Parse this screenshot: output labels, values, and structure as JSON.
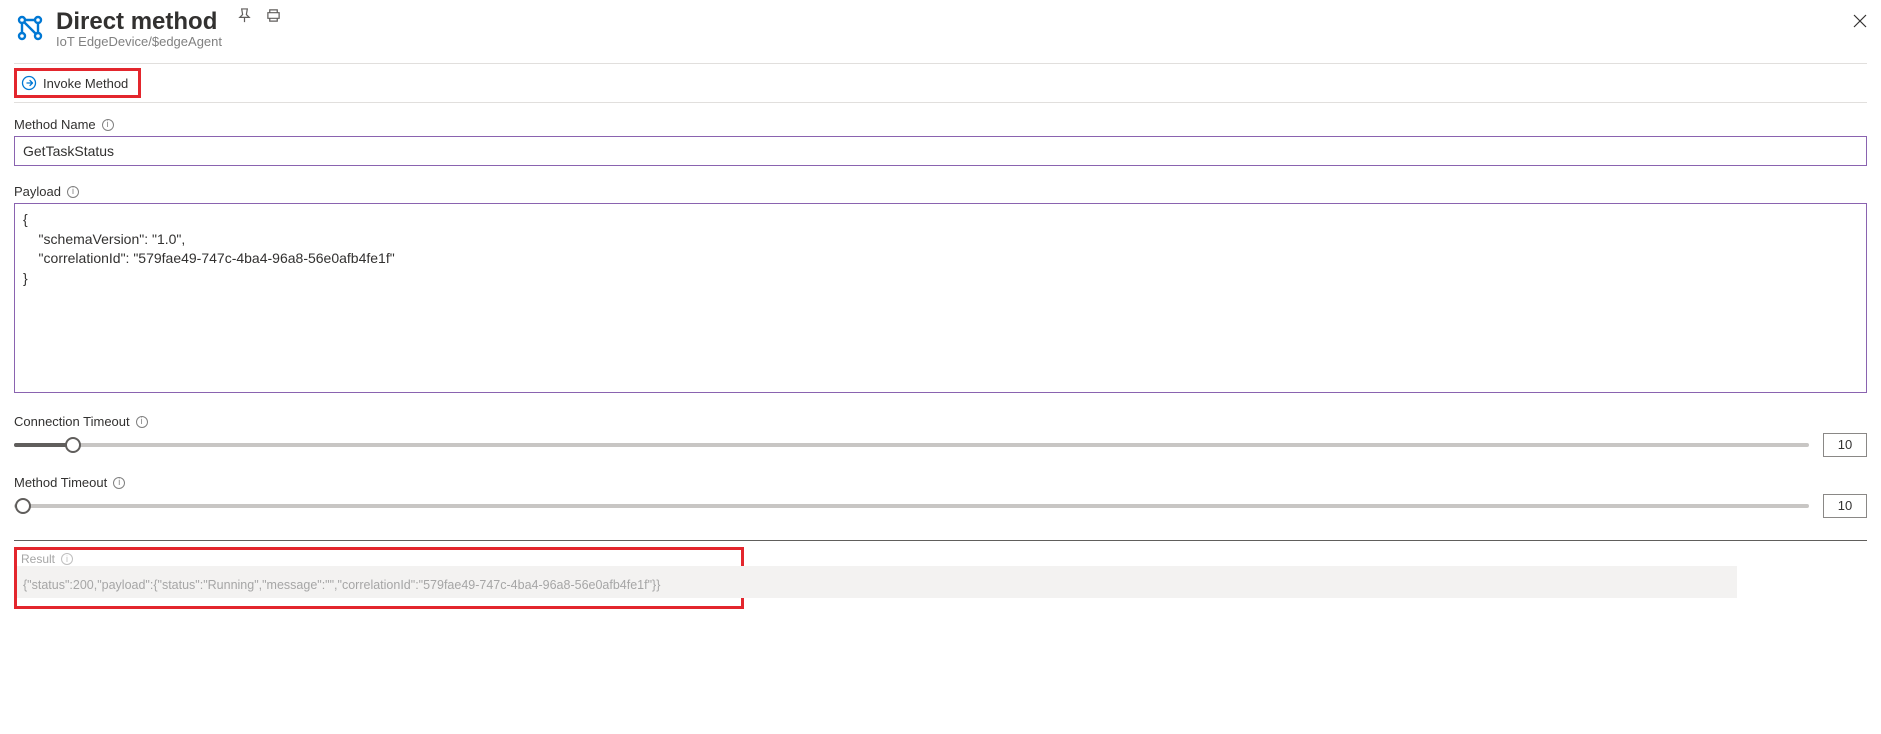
{
  "header": {
    "title": "Direct method",
    "subtitle": "IoT EdgeDevice/$edgeAgent"
  },
  "toolbar": {
    "invoke_label": "Invoke Method"
  },
  "form": {
    "method_name_label": "Method Name",
    "method_name_value": "GetTaskStatus",
    "payload_label": "Payload",
    "payload_value": "{\n    \"schemaVersion\": \"1.0\",\n    \"correlationId\": \"579fae49-747c-4ba4-96a8-56e0afb4fe1f\"\n}",
    "connection_timeout_label": "Connection Timeout",
    "connection_timeout_value": "10",
    "method_timeout_label": "Method Timeout",
    "method_timeout_value": "10"
  },
  "result": {
    "label": "Result",
    "value": "{\"status\":200,\"payload\":{\"status\":\"Running\",\"message\":\"\",\"correlationId\":\"579fae49-747c-4ba4-96a8-56e0afb4fe1f\"}}"
  }
}
